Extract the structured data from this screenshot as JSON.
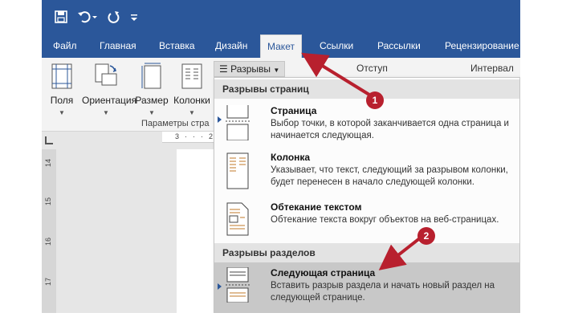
{
  "quick_access": {
    "save_icon": "save-icon",
    "undo_icon": "undo-icon",
    "redo_icon": "redo-icon",
    "customize_icon": "customize-qat-icon"
  },
  "tabs": [
    {
      "label": "Файл",
      "active": false
    },
    {
      "label": "Главная",
      "active": false
    },
    {
      "label": "Вставка",
      "active": false
    },
    {
      "label": "Дизайн",
      "active": false
    },
    {
      "label": "Макет",
      "active": true
    },
    {
      "label": "Ссылки",
      "active": false
    },
    {
      "label": "Рассылки",
      "active": false
    },
    {
      "label": "Рецензирование",
      "active": false
    }
  ],
  "ribbon": {
    "buttons": [
      {
        "label": "Поля",
        "icon": "margins-icon"
      },
      {
        "label": "Ориентация",
        "icon": "orientation-icon"
      },
      {
        "label": "Размер",
        "icon": "page-size-icon"
      },
      {
        "label": "Колонки",
        "icon": "columns-icon"
      }
    ],
    "breaks_button": "Разрывы",
    "indent_label": "Отступ",
    "spacing_label": "Интервал",
    "group_label": "Параметры стра"
  },
  "ruler": {
    "h_marks": [
      "3",
      "·",
      "·",
      "·",
      "2"
    ],
    "v_marks": [
      "14",
      "15",
      "16",
      "17"
    ]
  },
  "menu": {
    "page_breaks_header": "Разрывы страниц",
    "section_breaks_header": "Разрывы разделов",
    "items": [
      {
        "title": "Страница",
        "desc": "Выбор точки, в которой заканчивается одна страница и начинается следующая.",
        "icon": "page-break-icon"
      },
      {
        "title": "Колонка",
        "desc": "Указывает, что текст, следующий за разрывом колонки, будет перенесен в начало следующей колонки.",
        "icon": "column-break-icon"
      },
      {
        "title": "Обтекание текстом",
        "desc": "Обтекание текста вокруг объектов на веб-страницах.",
        "icon": "text-wrapping-icon"
      },
      {
        "title": "Следующая страница",
        "desc": "Вставить разрыв раздела и начать новый раздел на следующей странице.",
        "icon": "next-page-break-icon"
      }
    ]
  },
  "callouts": [
    "1",
    "2"
  ],
  "colors": {
    "word_blue": "#2b579a",
    "callout_red": "#b8202e",
    "highlight": "#c8c8c8"
  }
}
